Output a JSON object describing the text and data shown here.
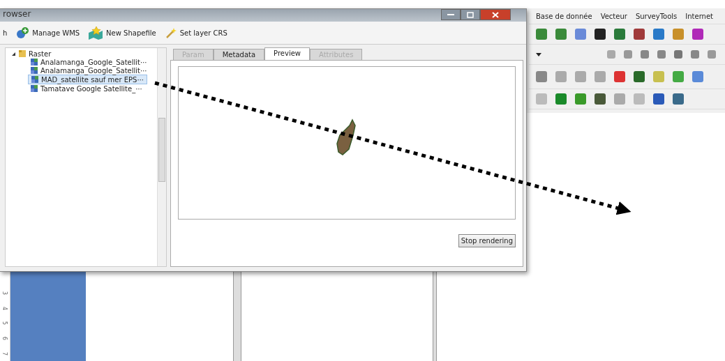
{
  "dialog": {
    "title": "rowser",
    "toolbar": [
      {
        "label": "h",
        "kind": "none"
      },
      {
        "label": "Manage WMS",
        "kind": "wms"
      },
      {
        "label": "New Shapefile",
        "kind": "shapefile"
      },
      {
        "label": "Set layer CRS",
        "kind": "crs"
      }
    ],
    "tree": [
      {
        "label": "Raster",
        "expanded": true,
        "selected": false,
        "children": [
          {
            "label": "Analamanga_Google_Satellit⋯",
            "selected": false
          },
          {
            "label": "Analamanga_Google_Satellit⋯",
            "selected": false
          },
          {
            "label": "MAD_satellite sauf mer EPS⋯",
            "selected": true
          },
          {
            "label": "Tamatave Google Satellite_⋯",
            "selected": false
          }
        ]
      }
    ],
    "tabs": [
      {
        "label": "Param",
        "selected": false,
        "disabled": true
      },
      {
        "label": "Metadata",
        "selected": false,
        "disabled": false
      },
      {
        "label": "Preview",
        "selected": true,
        "disabled": false
      },
      {
        "label": "Attributes",
        "selected": false,
        "disabled": true
      }
    ],
    "stop_button": "Stop rendering"
  },
  "main_window": {
    "menu": [
      "Base de donnée",
      "Vecteur",
      "SurveyTools",
      "Internet"
    ],
    "ruler": [
      "3",
      "4",
      "5",
      "6",
      "7"
    ]
  }
}
